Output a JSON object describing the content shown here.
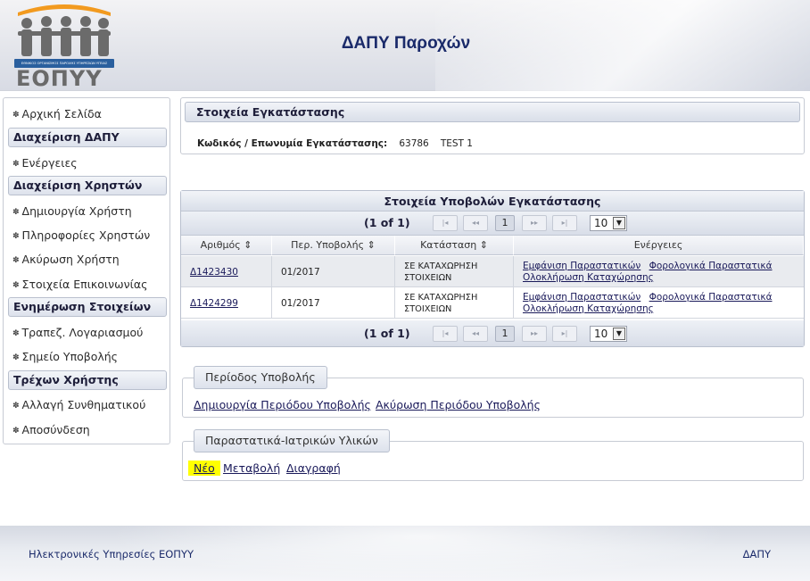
{
  "header": {
    "title": "ΔΑΠΥ Παροχών",
    "logo_text": "ΕΟΠΥΥ",
    "logo_org": "ΕΘΝΙΚΟΣ ΟΡΓΑΝΙΣΜΟΣ ΠΑΡΟΧΗΣ ΥΠΗΡΕΣΙΩΝ ΥΓΕΙΑΣ"
  },
  "sidebar": {
    "home": "Αρχική Σελίδα",
    "sections": [
      {
        "title": "Διαχείριση ΔΑΠΥ",
        "items": [
          "Ενέργειες"
        ]
      },
      {
        "title": "Διαχείριση Χρηστών",
        "items": [
          "Δημιουργία Χρήστη",
          "Πληροφορίες Χρηστών",
          "Ακύρωση Χρήστη",
          "Στοιχεία Επικοινωνίας"
        ]
      },
      {
        "title": "Ενημέρωση Στοιχείων",
        "items": [
          "Τραπεζ. Λογαριασμού",
          "Σημείο Υποβολής"
        ]
      },
      {
        "title": "Τρέχων Χρήστης",
        "items": [
          "Αλλαγή Συνθηματικού",
          "Αποσύνδεση"
        ]
      }
    ]
  },
  "facility": {
    "header": "Στοιχεία Εγκατάστασης",
    "label": "Κωδικός / Επωνυμία Εγκατάστασης:",
    "code": "63786",
    "name": "TEST 1"
  },
  "submissions": {
    "title": "Στοιχεία Υποβολών Εγκατάστασης",
    "pager": {
      "count": "(1 of 1)",
      "first": "|◂",
      "prev": "◂◂",
      "page": "1",
      "next": "▸▸",
      "last": "▸|",
      "page_size": "10"
    },
    "columns": [
      "Αριθμός",
      "Περ. Υποβολής",
      "Κατάσταση",
      "Ενέργειες"
    ],
    "sort_icon": "⇕",
    "rows": [
      {
        "number": "Δ1423430",
        "period": "01/2017",
        "status": "ΣΕ ΚΑΤΑΧΩΡΗΣΗ ΣΤΟΙΧΕΙΩΝ",
        "actions": [
          "Εμφάνιση Παραστατικών",
          "Φορολογικά Παραστατικά",
          "Ολοκλήρωση Καταχώρησης"
        ]
      },
      {
        "number": "Δ1424299",
        "period": "01/2017",
        "status": "ΣΕ ΚΑΤΑΧΩΡΗΣΗ ΣΤΟΙΧΕΙΩΝ",
        "actions": [
          "Εμφάνιση Παραστατικών",
          "Φορολογικά Παραστατικά",
          "Ολοκλήρωση Καταχώρησης"
        ]
      }
    ]
  },
  "period_box": {
    "legend": "Περίοδος Υποβολής",
    "links": [
      "Δημιουργία Περιόδου Υποβολής",
      "Ακύρωση Περιόδου Υποβολής"
    ]
  },
  "materials_box": {
    "legend": "Παραστατικά-Ιατρικών Υλικών",
    "links": [
      "Νέο",
      "Μεταβολή",
      "Διαγραφή"
    ],
    "highlight_color": "#ffff00"
  },
  "footer": {
    "left": "Ηλεκτρονικές Υπηρεσίες ΕΟΠΥΥ",
    "right": "ΔΑΠΥ"
  }
}
